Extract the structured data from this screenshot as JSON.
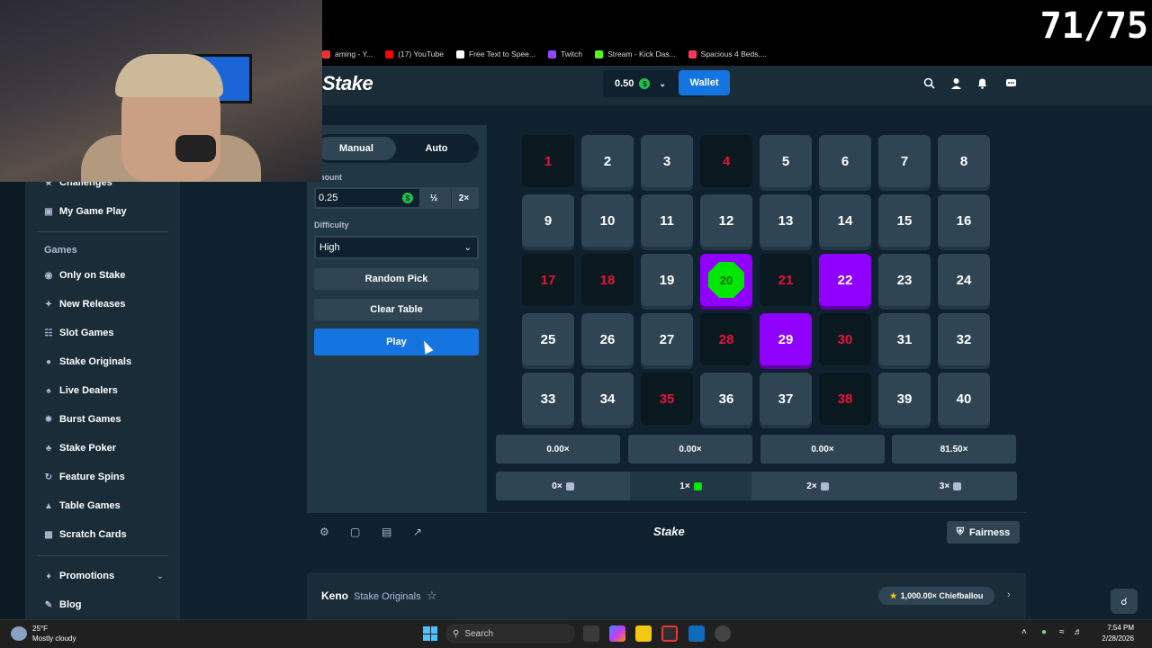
{
  "overlay": {
    "counter": "71/75"
  },
  "bookmarks": [
    {
      "label": "aming - Y...",
      "color": "#e33"
    },
    {
      "label": "(17) YouTube",
      "color": "#f00"
    },
    {
      "label": "Free Text to Spee...",
      "color": "#fff"
    },
    {
      "label": "Twitch",
      "color": "#9146ff"
    },
    {
      "label": "Stream - Kick Das...",
      "color": "#53fc18"
    },
    {
      "label": "Spacious 4 Beds,...",
      "color": "#ff385c"
    }
  ],
  "header": {
    "logo": "Stake",
    "balance": "0.50",
    "currency_symbol": "$",
    "wallet_label": "Wallet",
    "icons": [
      "search-icon",
      "user-icon",
      "bell-icon",
      "chat-icon"
    ]
  },
  "sidebar": {
    "top_items": [
      {
        "label": "Challenges",
        "icon": "trophy-icon"
      },
      {
        "label": "My Game Play",
        "icon": "gameplay-icon"
      }
    ],
    "games_heading": "Games",
    "items": [
      {
        "label": "Only on Stake",
        "icon": "stake-icon"
      },
      {
        "label": "New Releases",
        "icon": "sparkle-icon"
      },
      {
        "label": "Slot Games",
        "icon": "slot-icon"
      },
      {
        "label": "Stake Originals",
        "icon": "flame-icon"
      },
      {
        "label": "Live Dealers",
        "icon": "cards-icon"
      },
      {
        "label": "Burst Games",
        "icon": "burst-icon"
      },
      {
        "label": "Stake Poker",
        "icon": "poker-icon"
      },
      {
        "label": "Feature Spins",
        "icon": "spins-icon"
      },
      {
        "label": "Table Games",
        "icon": "table-icon"
      },
      {
        "label": "Scratch Cards",
        "icon": "scratch-icon"
      }
    ],
    "promotions_label": "Promotions",
    "blog_label": "Blog"
  },
  "controls": {
    "tabs": [
      "Manual",
      "Auto"
    ],
    "active_tab": "Manual",
    "amount_label": "nount",
    "amount_value": "0.25",
    "half_label": "½",
    "double_label": "2×",
    "difficulty_label": "Difficulty",
    "difficulty_value": "High",
    "random_pick_label": "Random Pick",
    "clear_table_label": "Clear Table",
    "play_label": "Play"
  },
  "board": {
    "tiles": [
      {
        "n": "1",
        "state": "miss"
      },
      {
        "n": "2",
        "state": "normal"
      },
      {
        "n": "3",
        "state": "normal"
      },
      {
        "n": "4",
        "state": "miss"
      },
      {
        "n": "5",
        "state": "normal"
      },
      {
        "n": "6",
        "state": "normal"
      },
      {
        "n": "7",
        "state": "normal"
      },
      {
        "n": "8",
        "state": "normal"
      },
      {
        "n": "9",
        "state": "normal"
      },
      {
        "n": "10",
        "state": "normal"
      },
      {
        "n": "11",
        "state": "normal"
      },
      {
        "n": "12",
        "state": "normal"
      },
      {
        "n": "13",
        "state": "normal"
      },
      {
        "n": "14",
        "state": "normal"
      },
      {
        "n": "15",
        "state": "normal"
      },
      {
        "n": "16",
        "state": "normal"
      },
      {
        "n": "17",
        "state": "miss"
      },
      {
        "n": "18",
        "state": "miss"
      },
      {
        "n": "19",
        "state": "normal"
      },
      {
        "n": "20",
        "state": "gem"
      },
      {
        "n": "21",
        "state": "miss"
      },
      {
        "n": "22",
        "state": "hit"
      },
      {
        "n": "23",
        "state": "normal"
      },
      {
        "n": "24",
        "state": "normal"
      },
      {
        "n": "25",
        "state": "normal"
      },
      {
        "n": "26",
        "state": "normal"
      },
      {
        "n": "27",
        "state": "normal"
      },
      {
        "n": "28",
        "state": "miss"
      },
      {
        "n": "29",
        "state": "hit"
      },
      {
        "n": "30",
        "state": "miss"
      },
      {
        "n": "31",
        "state": "normal"
      },
      {
        "n": "32",
        "state": "normal"
      },
      {
        "n": "33",
        "state": "normal"
      },
      {
        "n": "34",
        "state": "normal"
      },
      {
        "n": "35",
        "state": "miss"
      },
      {
        "n": "36",
        "state": "normal"
      },
      {
        "n": "37",
        "state": "normal"
      },
      {
        "n": "38",
        "state": "miss"
      },
      {
        "n": "39",
        "state": "normal"
      },
      {
        "n": "40",
        "state": "normal"
      }
    ],
    "payouts": [
      "0.00×",
      "0.00×",
      "0.00×",
      "81.50×"
    ],
    "hits": [
      {
        "label": "0×",
        "marker": "gray"
      },
      {
        "label": "1×",
        "marker": "green"
      },
      {
        "label": "2×",
        "marker": "gray"
      },
      {
        "label": "3×",
        "marker": "gray"
      }
    ]
  },
  "footer": {
    "icons": [
      "settings-icon",
      "theatre-icon",
      "stats-icon",
      "popout-icon"
    ],
    "logo": "Stake",
    "fairness_label": "Fairness"
  },
  "info": {
    "title": "Keno",
    "subtitle": "Stake Originals",
    "leader": "1,000.00× Chiefballou"
  },
  "taskbar": {
    "temp": "25°F",
    "weather": "Mostly cloudy",
    "search_placeholder": "Search",
    "time": "7:54 PM",
    "date": "2/28/2026"
  },
  "colors": {
    "bg": "#0f212e",
    "panel": "#213743",
    "tile": "#2f4553",
    "accent_blue": "#1475e1",
    "hit_purple": "#9000ff",
    "gem_green": "#00e701",
    "miss_red": "#e9113c"
  }
}
